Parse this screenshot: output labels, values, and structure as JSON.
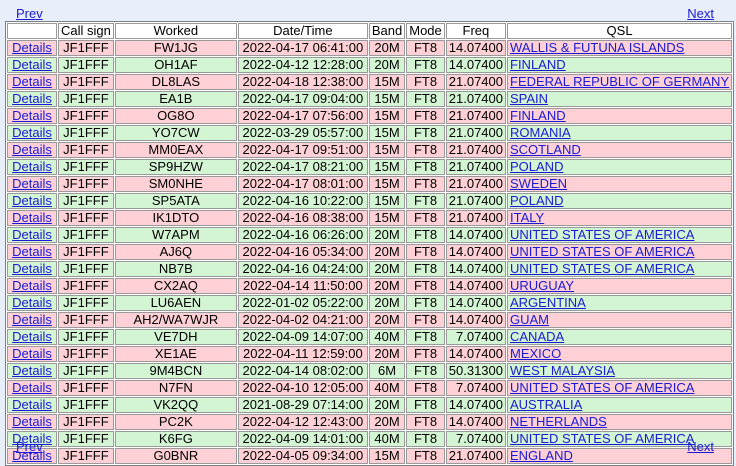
{
  "nav": {
    "prev_label": "Prev",
    "next_label": "Next"
  },
  "table": {
    "headers": [
      "",
      "Call sign",
      "Worked",
      "Date/Time",
      "Band",
      "Mode",
      "Freq",
      "QSL"
    ],
    "details_label": "Details",
    "row_colors": {
      "pink": "#ffd0d5",
      "green": "#d4f5d4"
    },
    "rows": [
      {
        "style": "pink",
        "call": "JF1FFF",
        "worked": "FW1JG",
        "datetime": "2022-04-17 06:41:00",
        "band": "20M",
        "mode": "FT8",
        "freq": "14.07400",
        "qsl": "WALLIS & FUTUNA ISLANDS"
      },
      {
        "style": "green",
        "call": "JF1FFF",
        "worked": "OH1AF",
        "datetime": "2022-04-12 12:28:00",
        "band": "20M",
        "mode": "FT8",
        "freq": "14.07400",
        "qsl": "FINLAND"
      },
      {
        "style": "pink",
        "call": "JF1FFF",
        "worked": "DL8LAS",
        "datetime": "2022-04-18 12:38:00",
        "band": "15M",
        "mode": "FT8",
        "freq": "21.07400",
        "qsl": "FEDERAL REPUBLIC OF GERMANY"
      },
      {
        "style": "green",
        "call": "JF1FFF",
        "worked": "EA1B",
        "datetime": "2022-04-17 09:04:00",
        "band": "15M",
        "mode": "FT8",
        "freq": "21.07400",
        "qsl": "SPAIN"
      },
      {
        "style": "pink",
        "call": "JF1FFF",
        "worked": "OG8O",
        "datetime": "2022-04-17 07:56:00",
        "band": "15M",
        "mode": "FT8",
        "freq": "21.07400",
        "qsl": "FINLAND"
      },
      {
        "style": "green",
        "call": "JF1FFF",
        "worked": "YO7CW",
        "datetime": "2022-03-29 05:57:00",
        "band": "15M",
        "mode": "FT8",
        "freq": "21.07400",
        "qsl": "ROMANIA"
      },
      {
        "style": "pink",
        "call": "JF1FFF",
        "worked": "MM0EAX",
        "datetime": "2022-04-17 09:51:00",
        "band": "15M",
        "mode": "FT8",
        "freq": "21.07400",
        "qsl": "SCOTLAND"
      },
      {
        "style": "green",
        "call": "JF1FFF",
        "worked": "SP9HZW",
        "datetime": "2022-04-17 08:21:00",
        "band": "15M",
        "mode": "FT8",
        "freq": "21.07400",
        "qsl": "POLAND"
      },
      {
        "style": "pink",
        "call": "JF1FFF",
        "worked": "SM0NHE",
        "datetime": "2022-04-17 08:01:00",
        "band": "15M",
        "mode": "FT8",
        "freq": "21.07400",
        "qsl": "SWEDEN"
      },
      {
        "style": "green",
        "call": "JF1FFF",
        "worked": "SP5ATA",
        "datetime": "2022-04-16 10:22:00",
        "band": "15M",
        "mode": "FT8",
        "freq": "21.07400",
        "qsl": "POLAND"
      },
      {
        "style": "pink",
        "call": "JF1FFF",
        "worked": "IK1DTO",
        "datetime": "2022-04-16 08:38:00",
        "band": "15M",
        "mode": "FT8",
        "freq": "21.07400",
        "qsl": "ITALY"
      },
      {
        "style": "green",
        "call": "JF1FFF",
        "worked": "W7APM",
        "datetime": "2022-04-16 06:26:00",
        "band": "20M",
        "mode": "FT8",
        "freq": "14.07400",
        "qsl": "UNITED STATES OF AMERICA"
      },
      {
        "style": "pink",
        "call": "JF1FFF",
        "worked": "AJ6Q",
        "datetime": "2022-04-16 05:34:00",
        "band": "20M",
        "mode": "FT8",
        "freq": "14.07400",
        "qsl": "UNITED STATES OF AMERICA"
      },
      {
        "style": "green",
        "call": "JF1FFF",
        "worked": "NB7B",
        "datetime": "2022-04-16 04:24:00",
        "band": "20M",
        "mode": "FT8",
        "freq": "14.07400",
        "qsl": "UNITED STATES OF AMERICA"
      },
      {
        "style": "pink",
        "call": "JF1FFF",
        "worked": "CX2AQ",
        "datetime": "2022-04-14 11:50:00",
        "band": "20M",
        "mode": "FT8",
        "freq": "14.07400",
        "qsl": "URUGUAY"
      },
      {
        "style": "green",
        "call": "JF1FFF",
        "worked": "LU6AEN",
        "datetime": "2022-01-02 05:22:00",
        "band": "20M",
        "mode": "FT8",
        "freq": "14.07400",
        "qsl": "ARGENTINA"
      },
      {
        "style": "pink",
        "call": "JF1FFF",
        "worked": "AH2/WA7WJR",
        "datetime": "2022-04-02 04:21:00",
        "band": "20M",
        "mode": "FT8",
        "freq": "14.07400",
        "qsl": "GUAM"
      },
      {
        "style": "green",
        "call": "JF1FFF",
        "worked": "VE7DH",
        "datetime": "2022-04-09 14:07:00",
        "band": "40M",
        "mode": "FT8",
        "freq": "7.07400",
        "qsl": "CANADA"
      },
      {
        "style": "pink",
        "call": "JF1FFF",
        "worked": "XE1AE",
        "datetime": "2022-04-11 12:59:00",
        "band": "20M",
        "mode": "FT8",
        "freq": "14.07400",
        "qsl": "MEXICO"
      },
      {
        "style": "green",
        "call": "JF1FFF",
        "worked": "9M4BCN",
        "datetime": "2022-04-14 08:02:00",
        "band": "6M",
        "mode": "FT8",
        "freq": "50.31300",
        "qsl": "WEST MALAYSIA"
      },
      {
        "style": "pink",
        "call": "JF1FFF",
        "worked": "N7FN",
        "datetime": "2022-04-10 12:05:00",
        "band": "40M",
        "mode": "FT8",
        "freq": "7.07400",
        "qsl": "UNITED STATES OF AMERICA"
      },
      {
        "style": "green",
        "call": "JF1FFF",
        "worked": "VK2QQ",
        "datetime": "2021-08-29 07:14:00",
        "band": "20M",
        "mode": "FT8",
        "freq": "14.07400",
        "qsl": "AUSTRALIA"
      },
      {
        "style": "pink",
        "call": "JF1FFF",
        "worked": "PC2K",
        "datetime": "2022-04-12 12:43:00",
        "band": "20M",
        "mode": "FT8",
        "freq": "14.07400",
        "qsl": "NETHERLANDS"
      },
      {
        "style": "green",
        "call": "JF1FFF",
        "worked": "K6FG",
        "datetime": "2022-04-09 14:01:00",
        "band": "40M",
        "mode": "FT8",
        "freq": "7.07400",
        "qsl": "UNITED STATES OF AMERICA"
      },
      {
        "style": "pink",
        "call": "JF1FFF",
        "worked": "G0BNR",
        "datetime": "2022-04-05 09:34:00",
        "band": "15M",
        "mode": "FT8",
        "freq": "21.07400",
        "qsl": "ENGLAND"
      }
    ]
  }
}
